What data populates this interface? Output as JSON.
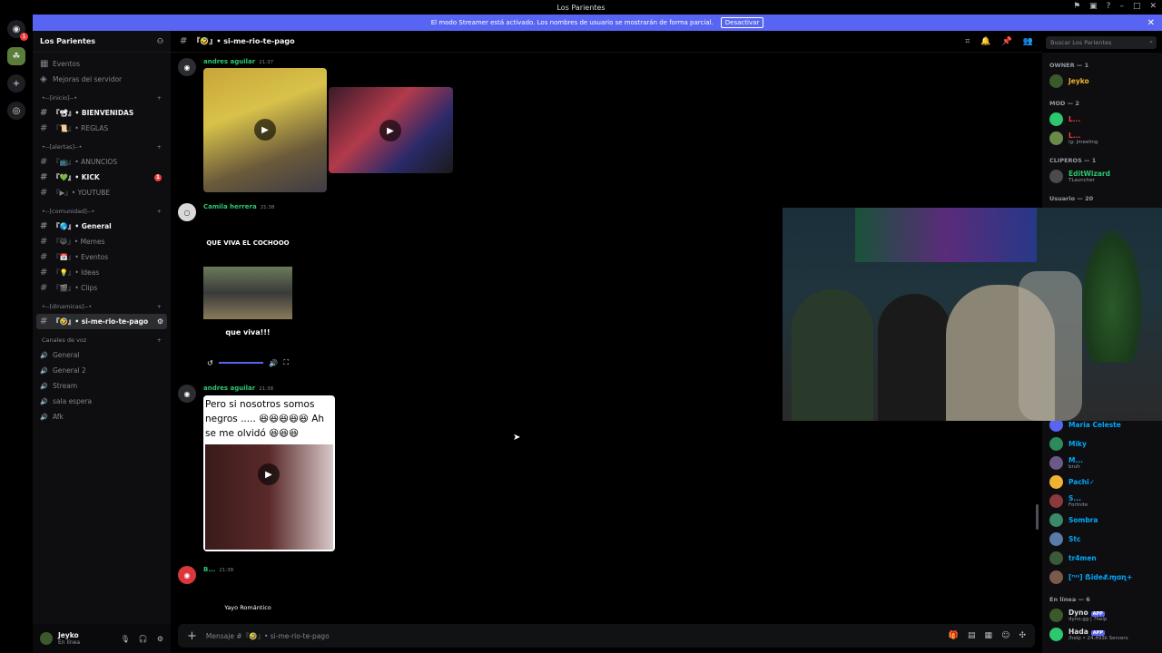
{
  "window": {
    "title": "Los Parientes"
  },
  "banner": {
    "text": "El modo Streamer está activado. Los nombres de usuario se mostrarán de forma parcial.",
    "button": "Desactivar",
    "color": "#5865f2"
  },
  "server": {
    "name": "Los Parientes",
    "top_items": [
      {
        "label": "Eventos",
        "icon": "calendar-icon"
      },
      {
        "label": "Mejoras del servidor",
        "icon": "boost-icon"
      }
    ],
    "categories": [
      {
        "label": "•--[inicio]--•",
        "channels": [
          {
            "label": "『📽』• BIENVENIDAS",
            "bold": true,
            "badge": ""
          },
          {
            "label": "『📜』• REGLAS",
            "bold": false,
            "badge": ""
          }
        ]
      },
      {
        "label": "•--[alertas]--•",
        "channels": [
          {
            "label": "『📺』• ANUNCIOS",
            "bold": false,
            "badge": ""
          },
          {
            "label": "『💚』• KICK",
            "bold": true,
            "badge": "1"
          },
          {
            "label": "『▶』• YOUTUBE",
            "bold": false,
            "badge": ""
          }
        ]
      },
      {
        "label": "•--[comunidad]--•",
        "channels": [
          {
            "label": "『🌎』• General",
            "bold": true,
            "badge": ""
          },
          {
            "label": "『😹』• Memes",
            "bold": false,
            "badge": ""
          },
          {
            "label": "『📅』• Eventos",
            "bold": false,
            "badge": ""
          },
          {
            "label": "『💡』• Ideas",
            "bold": false,
            "badge": ""
          },
          {
            "label": "『🎬』• Clips",
            "bold": false,
            "badge": ""
          }
        ]
      },
      {
        "label": "•--[dinamicas]--•",
        "channels": [
          {
            "label": "『🤣』• si-me-rio-te-pago",
            "bold": true,
            "badge": "",
            "selected": true
          }
        ]
      }
    ],
    "voice_category": "Canales de voz",
    "voice_channels": [
      "General",
      "General 2",
      "Stream",
      "sala espera",
      "Afk"
    ]
  },
  "user": {
    "name": "Jeyko",
    "status": "En línea"
  },
  "channel": {
    "name": "『🤣』• si-me-rio-te-pago",
    "search_placeholder": "Buscar Los Parientes"
  },
  "messages": [
    {
      "author": "andres aguilar",
      "time": "21:37",
      "color": "#2dc770"
    },
    {
      "author": "Camila herrera",
      "time": "21:38",
      "color": "#2dc770",
      "caption_top": "QUE VIVA EL COCHOOO",
      "caption_bottom": "que viva!!!"
    },
    {
      "author": "andres aguilar",
      "time": "21:38",
      "color": "#2dc770",
      "caption": "Pero si nosotros somos negros ..... 😆😆😆😆😆 Ah se me olvidó 😆😆😆"
    },
    {
      "author": "B...",
      "time": "21:38",
      "color": "#2dc770",
      "caption": "Yayo Romántico"
    }
  ],
  "composer": {
    "placeholder": "Mensaje #『🤣』• si-me-rio-te-pago"
  },
  "members": {
    "groups": [
      {
        "label": "OWNER — 1",
        "items": [
          {
            "name": "Jeyko",
            "sub": "",
            "color": "#f0b232"
          }
        ]
      },
      {
        "label": "MOD — 2",
        "items": [
          {
            "name": "L...",
            "sub": "",
            "color": "#f23f43"
          },
          {
            "name": "L...",
            "sub": "ig: jmeeling",
            "color": "#f23f43"
          }
        ]
      },
      {
        "label": "CLIPEROS — 1",
        "items": [
          {
            "name": "EditWizard",
            "sub": "TLauncher",
            "color": "#2dc770"
          }
        ]
      },
      {
        "label": "Usuario — 20",
        "items": []
      }
    ],
    "lower": [
      {
        "name": "Maria Celeste",
        "sub": "",
        "color": "#00a8fc"
      },
      {
        "name": "Miky",
        "sub": "",
        "color": "#00a8fc"
      },
      {
        "name": "M...",
        "sub": "bruh",
        "color": "#00a8fc"
      },
      {
        "name": "Pachi✓",
        "sub": "",
        "color": "#00a8fc"
      },
      {
        "name": "S...",
        "sub": "Fortnite",
        "color": "#00a8fc"
      },
      {
        "name": "Sombra",
        "sub": "",
        "color": "#00a8fc"
      },
      {
        "name": "Stc",
        "sub": "",
        "color": "#00a8fc"
      },
      {
        "name": "tr4men",
        "sub": "",
        "color": "#00a8fc"
      },
      {
        "name": "[ʳᵘˢ] ẞide𝓔.ɱɑɳ+",
        "sub": "",
        "color": "#00a8fc"
      }
    ],
    "online_label": "En línea — 6",
    "online": [
      {
        "name": "Dyno",
        "tag": "APP",
        "sub": "dyno.gg | ?help"
      },
      {
        "name": "Hada",
        "tag": "APP",
        "sub": "/help • 24,493k Servers"
      }
    ]
  }
}
